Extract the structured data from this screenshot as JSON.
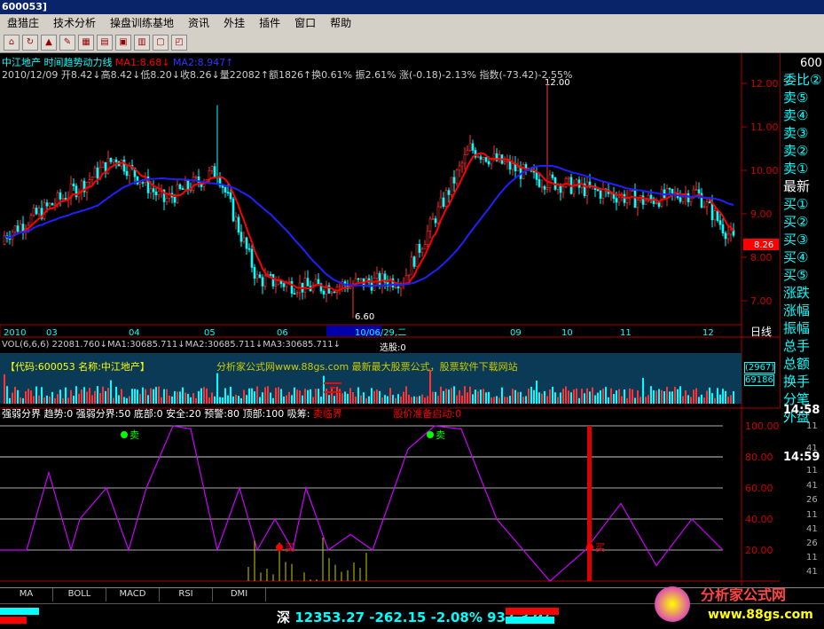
{
  "window": {
    "title": "600053]"
  },
  "menu": [
    "盘猎庄",
    "技术分析",
    "操盘训练基地",
    "资讯",
    "外挂",
    "插件",
    "窗口",
    "帮助"
  ],
  "toolbar_icons": [
    "home-icon",
    "refresh-icon",
    "alert-icon",
    "draw-icon",
    "grid-icon",
    "layout-icon",
    "minute-icon",
    "kline-icon",
    "news-icon",
    "chart-icon"
  ],
  "main": {
    "title": "中江地产 时间趋势动力线",
    "ma1": "MA1:8.68↓",
    "ma2": "MA2:8.947↑",
    "info": "2010/12/09 开8.42↓高8.42↓低8.20↓收8.26↓量22082↑额1826↑换0.61% 振2.61% 涨(-0.18)-2.13% 指数(-73.42)-2.55%",
    "hi": "12.00",
    "lo": "6.60",
    "last": "8.26",
    "mark": "10/06/29,二",
    "ylab": [
      "12.00",
      "11.00",
      "10.00",
      "9.00",
      "8.00",
      "7.00"
    ],
    "months": [
      "2010",
      "03",
      "04",
      "05",
      "06",
      "10/06/29,二",
      "09",
      "10",
      "11",
      "12"
    ],
    "period": "日线"
  },
  "vol": {
    "info": "VOL(6,6,6) 22081.760↓MA1:30685.711↓MA2:30685.711↓MA3:30685.711↓",
    "pick": "选股:0",
    "code": "【代码:600053 名称:中江地产】",
    "ad": "分析家公式网www.88gs.com 最新最大股票公式，股票软件下载网站",
    "b1": "(2967)",
    "b2": "69186"
  },
  "ind": {
    "info": "强弱分界 趋势:0 强弱分界:50 底部:0 安全:20 预警:80 顶部:100 吸筹:",
    "warn": "卖临界",
    "pre": "股价准备启动:0",
    "sell": "卖",
    "buy": "买",
    "ylab": [
      "100.00",
      "80.00",
      "60.00",
      "40.00",
      "20.00"
    ]
  },
  "right": {
    "code": "600",
    "labels": [
      "委比②",
      "卖⑤",
      "卖④",
      "卖③",
      "卖②",
      "卖①",
      "最新",
      "买①",
      "买②",
      "买③",
      "买④",
      "买⑤",
      "涨跌",
      "涨幅",
      "振幅",
      "总手",
      "总额",
      "换手",
      "分笔",
      "外盘"
    ],
    "times": [
      "14:58",
      "11",
      "41",
      "14:59",
      "11",
      "41",
      "26",
      "11",
      "41",
      "26",
      "11",
      "41"
    ]
  },
  "tabs": [
    "MA",
    "BOLL",
    "MACD",
    "RSI",
    "DMI"
  ],
  "status": {
    "market": "深",
    "index": "12353.27",
    "change": "-262.15",
    "pct": "-2.08%",
    "amount": "937.37亿",
    "logo": "分析家公式网",
    "url": "www.88gs.com"
  },
  "colors": {
    "red": "#ff0000",
    "blue": "#1010ff",
    "cyan": "#00ffff",
    "yellow": "#ffff00"
  }
}
